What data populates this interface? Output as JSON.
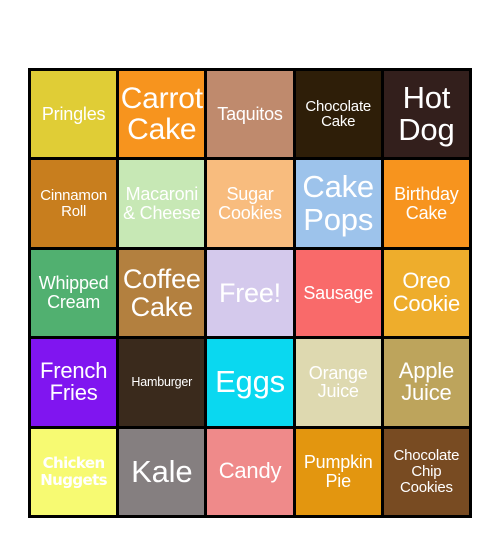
{
  "card": {
    "rows": [
      [
        {
          "label": "Pringles",
          "bg": "#e0cd36",
          "size": "fs-m"
        },
        {
          "label": "Carrot Cake",
          "bg": "#f7941e",
          "size": "fs-xxl"
        },
        {
          "label": "Taquitos",
          "bg": "#bf8a6d",
          "size": "fs-m"
        },
        {
          "label": "Chocolate Cake",
          "bg": "#2e1e08",
          "size": "fs-s"
        },
        {
          "label": "Hot Dog",
          "bg": "#331f1c",
          "size": "fs-xxl"
        }
      ],
      [
        {
          "label": "Cinnamon Roll",
          "bg": "#c87e1e",
          "size": "fs-s"
        },
        {
          "label": "Macaroni & Cheese",
          "bg": "#c7e8b5",
          "size": "fs-m"
        },
        {
          "label": "Sugar Cookies",
          "bg": "#f8bc7e",
          "size": "fs-m"
        },
        {
          "label": "Cake Pops",
          "bg": "#9dc3eb",
          "size": "fs-xxl"
        },
        {
          "label": "Birthday Cake",
          "bg": "#f7941e",
          "size": "fs-m"
        }
      ],
      [
        {
          "label": "Whipped Cream",
          "bg": "#51b070",
          "size": "fs-m"
        },
        {
          "label": "Coffee Cake",
          "bg": "#b3803f",
          "size": "fs-xl"
        },
        {
          "label": "Free!",
          "bg": "#d4c9ec",
          "size": "fs-xl"
        },
        {
          "label": "Sausage",
          "bg": "#f96a6a",
          "size": "fs-m"
        },
        {
          "label": "Oreo Cookie",
          "bg": "#eead2c",
          "size": "fs-l"
        }
      ],
      [
        {
          "label": "French Fries",
          "bg": "#8015f0",
          "size": "fs-l"
        },
        {
          "label": "Hamburger",
          "bg": "#3a2a1c",
          "size": "fs-xs"
        },
        {
          "label": "Eggs",
          "bg": "#0ad8f0",
          "size": "fs-xxl"
        },
        {
          "label": "Orange Juice",
          "bg": "#ded9b0",
          "size": "fs-m"
        },
        {
          "label": "Apple Juice",
          "bg": "#bda45c",
          "size": "fs-l"
        }
      ],
      [
        {
          "label": "Chicken Nuggets",
          "bg": "#f7fa72",
          "size": "chunky"
        },
        {
          "label": "Kale",
          "bg": "#857f80",
          "size": "fs-xxl"
        },
        {
          "label": "Candy",
          "bg": "#ef8a8a",
          "size": "fs-l"
        },
        {
          "label": "Pumpkin Pie",
          "bg": "#e3960f",
          "size": "fs-m"
        },
        {
          "label": "Chocolate Chip Cookies",
          "bg": "#784b22",
          "size": "fs-s"
        }
      ]
    ]
  }
}
